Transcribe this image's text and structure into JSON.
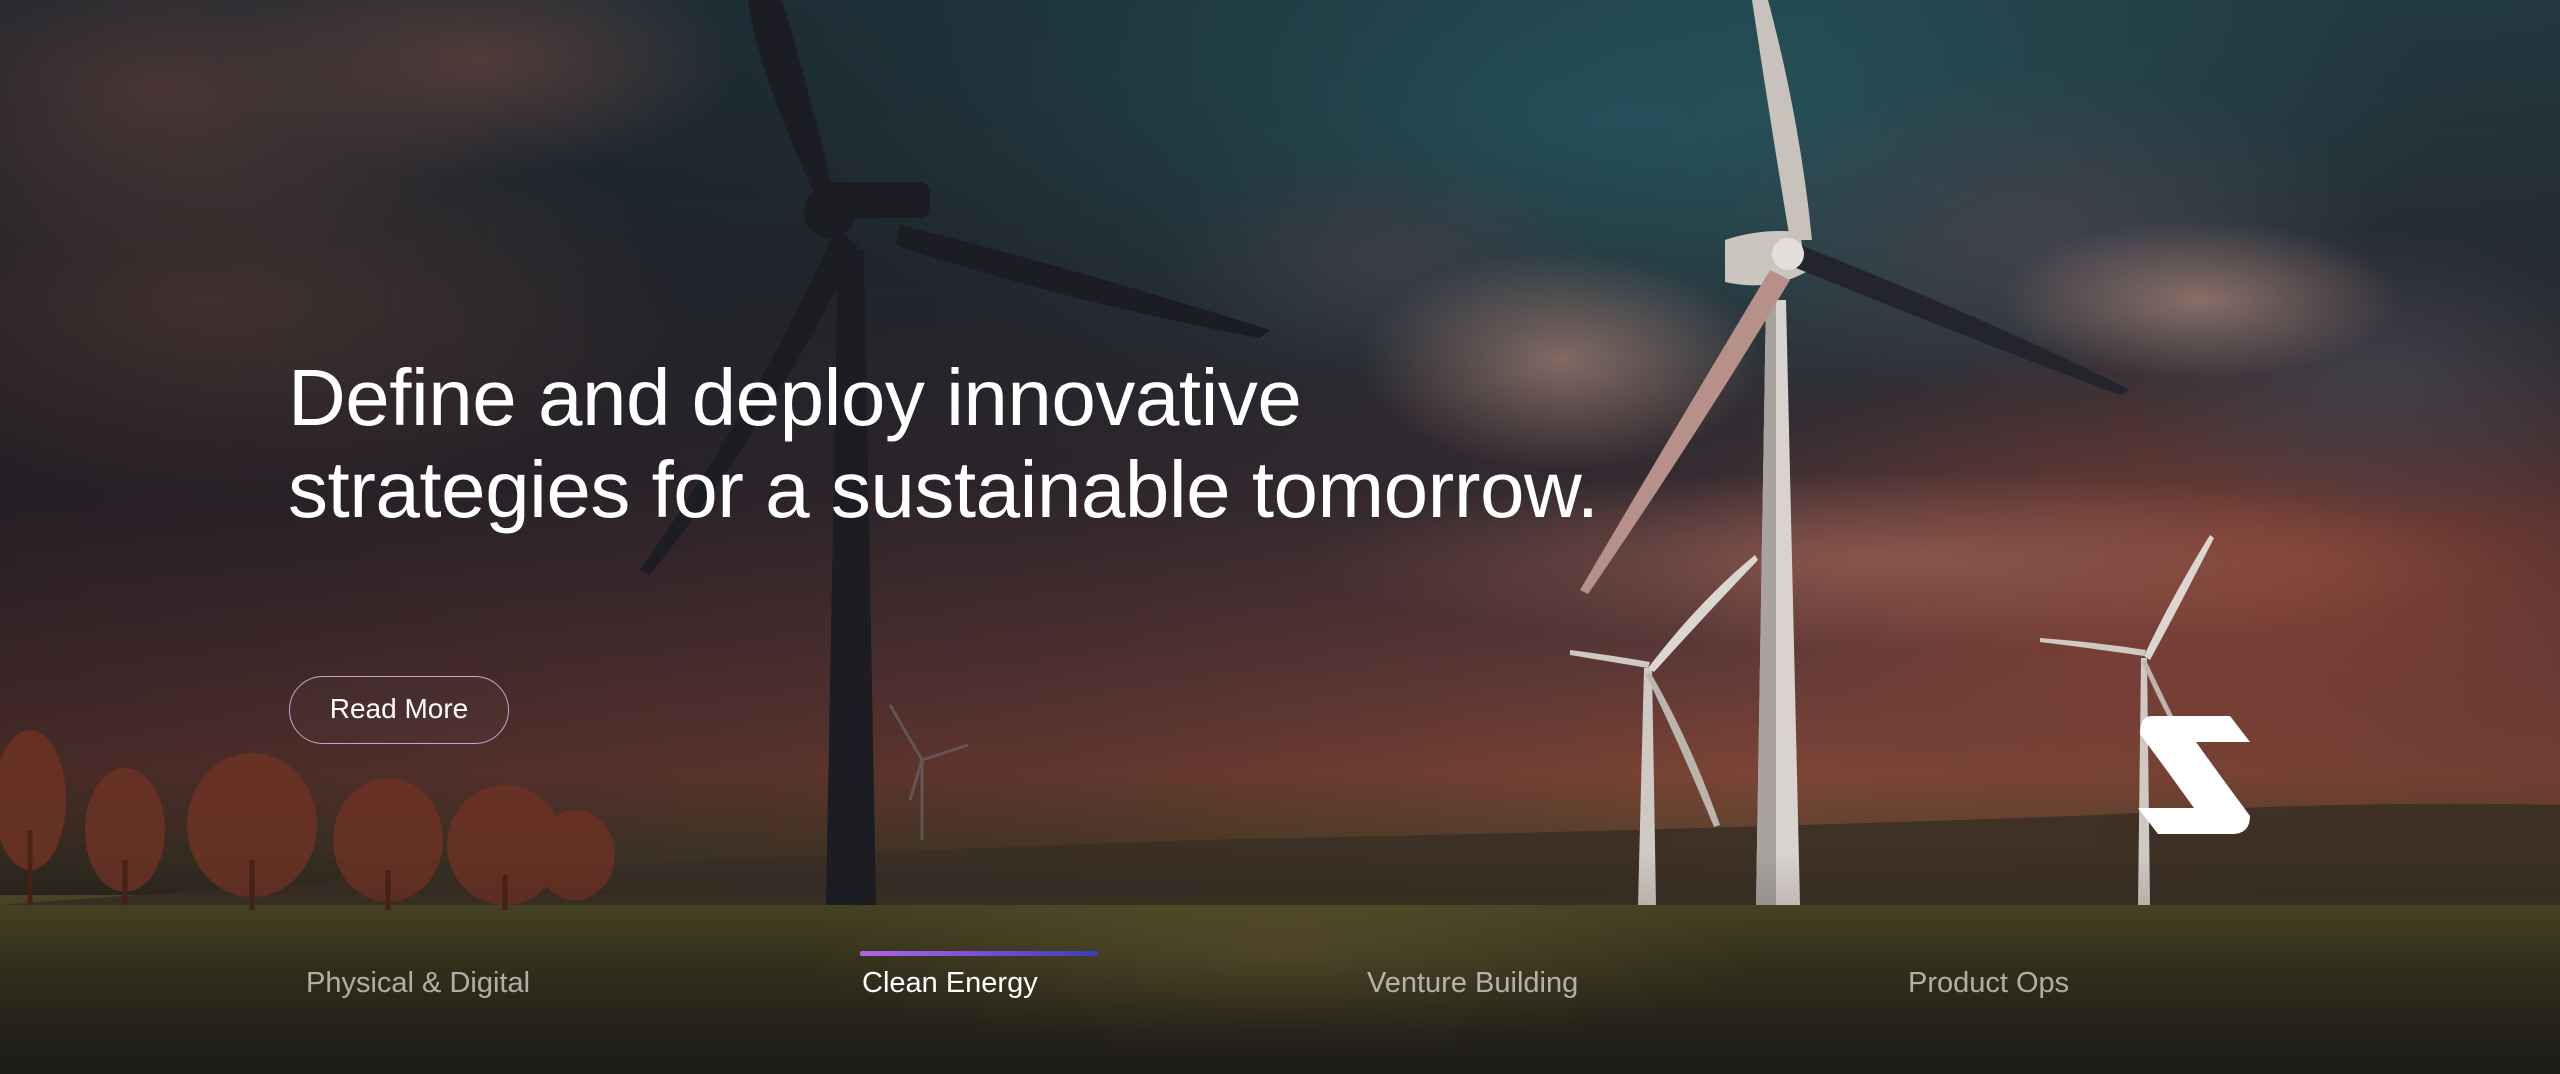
{
  "hero": {
    "headline_line1": "Define and deploy innovative",
    "headline_line2": "strategies for a sustainable tomorrow.",
    "cta_label": "Read More",
    "cta_border_color": "#c9a3d6",
    "background_image": "wind-turbines-at-sunset"
  },
  "brand": {
    "logo_icon": "s-logo-icon",
    "logo_color": "#ffffff"
  },
  "tabs": {
    "active_index": 1,
    "indicator_gradient": [
      "#b066e6",
      "#7a4fd8",
      "#3a3fb8"
    ],
    "items": [
      {
        "label": "Physical & Digital"
      },
      {
        "label": "Clean Energy"
      },
      {
        "label": "Venture Building"
      },
      {
        "label": "Product Ops"
      }
    ]
  }
}
